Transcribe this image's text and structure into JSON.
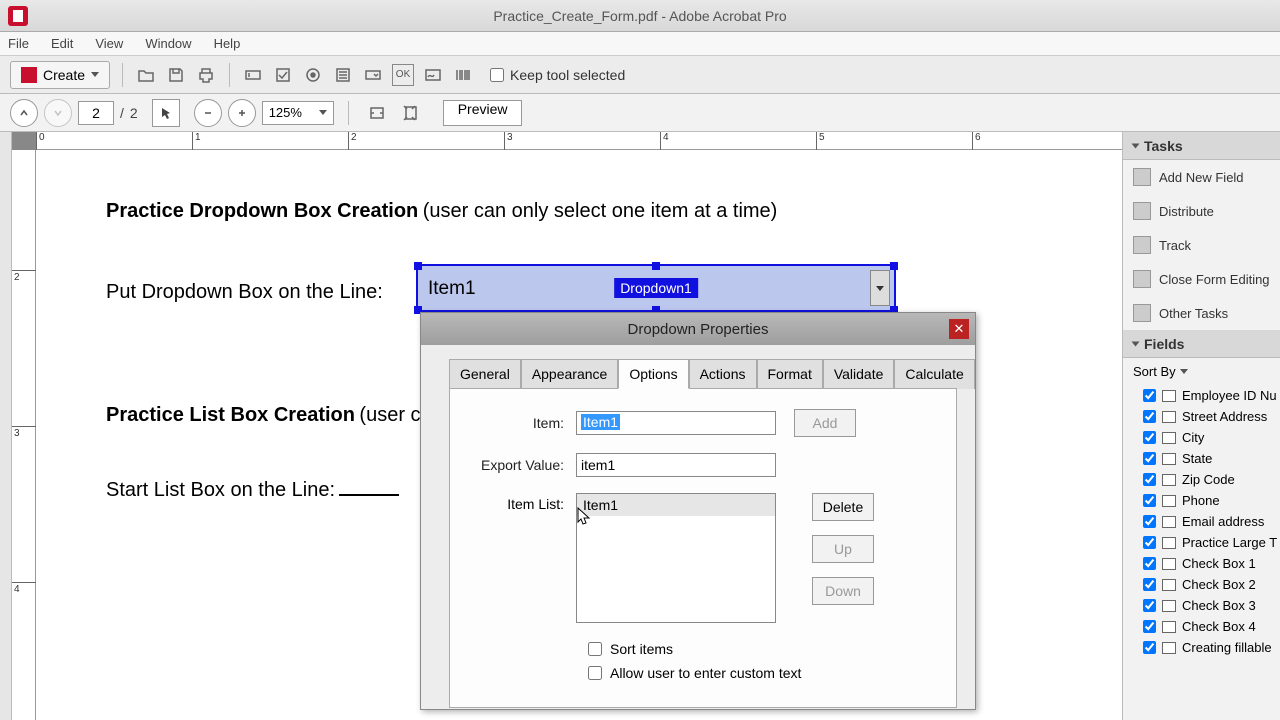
{
  "titlebar": {
    "title": "Practice_Create_Form.pdf - Adobe Acrobat Pro"
  },
  "menubar": {
    "file": "File",
    "edit": "Edit",
    "view": "View",
    "window": "Window",
    "help": "Help"
  },
  "toolbar": {
    "create": "Create",
    "keep_tool": "Keep tool selected"
  },
  "navbar": {
    "page": "2",
    "page_sep": "/",
    "page_total": "2",
    "zoom": "125%",
    "preview": "Preview"
  },
  "ruler_h": [
    "0",
    "1",
    "2",
    "3",
    "4",
    "5",
    "6"
  ],
  "ruler_v": [
    "2",
    "3",
    "4"
  ],
  "document": {
    "h1": "Practice Dropdown Box Creation",
    "h1_hint": " (user can only select one item at a time)",
    "line1": "Put Dropdown Box on the Line:",
    "h2": "Practice List Box Creation",
    "h2_hint": " (user c",
    "line2": "Start List Box on the Line:"
  },
  "widget": {
    "item": "Item1",
    "name": "Dropdown1"
  },
  "dialog": {
    "title": "Dropdown Properties",
    "tabs": {
      "general": "General",
      "appearance": "Appearance",
      "options": "Options",
      "actions": "Actions",
      "format": "Format",
      "validate": "Validate",
      "calculate": "Calculate"
    },
    "item_label": "Item:",
    "item_value": "Item1",
    "export_label": "Export Value:",
    "export_value": "item1",
    "itemlist_label": "Item List:",
    "list_items": [
      "Item1"
    ],
    "add": "Add",
    "delete": "Delete",
    "up": "Up",
    "down": "Down",
    "sort_items": "Sort items",
    "allow_custom": "Allow user to enter custom text"
  },
  "tasks": {
    "header": "Tasks",
    "add_field": "Add New Field",
    "distribute": "Distribute",
    "track": "Track",
    "close_editing": "Close Form Editing",
    "other": "Other Tasks"
  },
  "fields": {
    "header": "Fields",
    "sortby": "Sort By",
    "items": [
      "Employee ID Nu",
      "Street Address",
      "City",
      "State",
      "Zip Code",
      "Phone",
      "Email address",
      "Practice Large T",
      "Check Box 1",
      "Check Box 2",
      "Check Box 3",
      "Check Box 4",
      "Creating fillable"
    ]
  }
}
